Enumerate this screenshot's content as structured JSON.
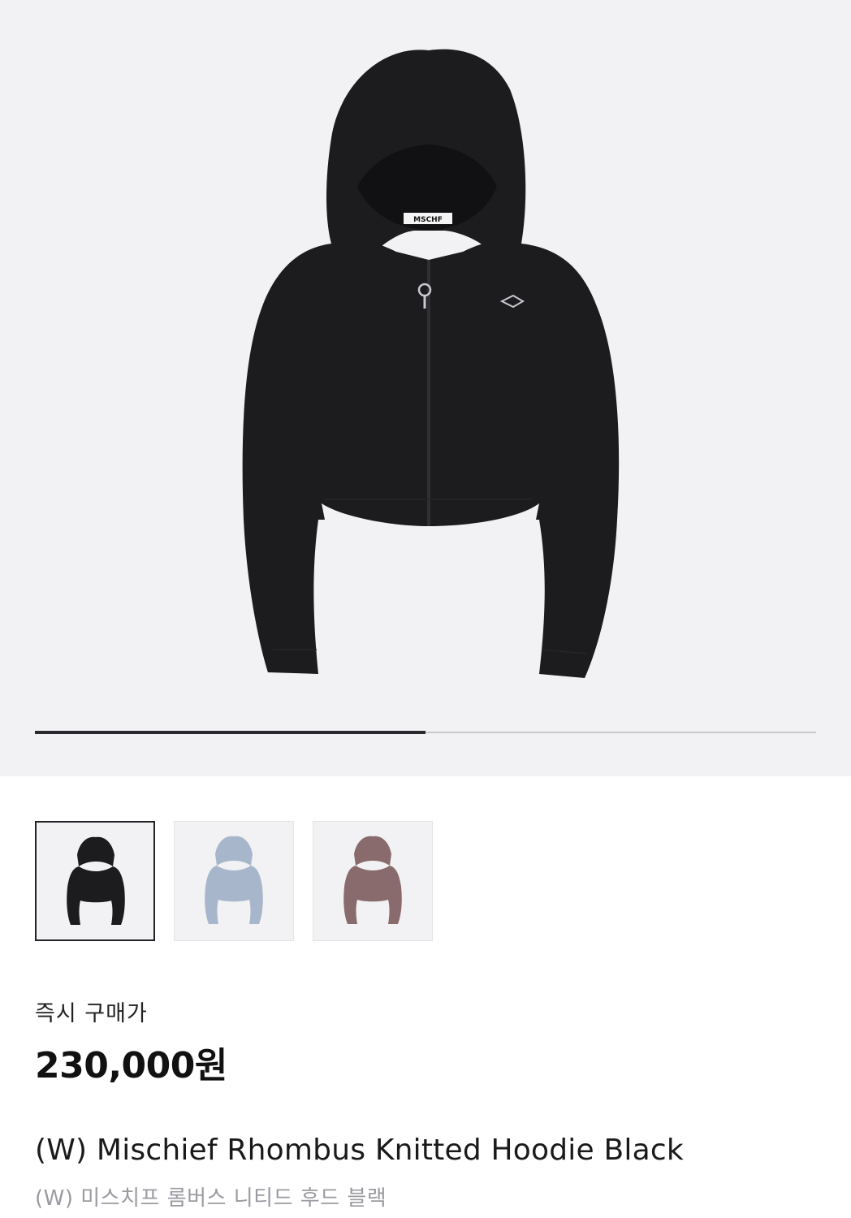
{
  "product": {
    "brand_tag": "MSCHF",
    "image": {
      "subject": "black cropped zip-up knitted hoodie",
      "icon": "hoodie-image"
    }
  },
  "gallery": {
    "progress": 0.5,
    "colors": {
      "track": "#c8c8cc",
      "fill": "#2a2a2e"
    }
  },
  "thumbnails": [
    {
      "color_name": "black",
      "hex": "#1c1c1f",
      "selected": true
    },
    {
      "color_name": "blue",
      "hex": "#a8b6cc",
      "selected": false
    },
    {
      "color_name": "mauve",
      "hex": "#8a6b6d",
      "selected": false
    }
  ],
  "pricing": {
    "label": "즉시 구매가",
    "price": "230,000원"
  },
  "title": {
    "english": "(W) Mischief Rhombus Knitted Hoodie Black",
    "korean": "(W) 미스치프 롬버스 니티드 후드 블랙"
  }
}
